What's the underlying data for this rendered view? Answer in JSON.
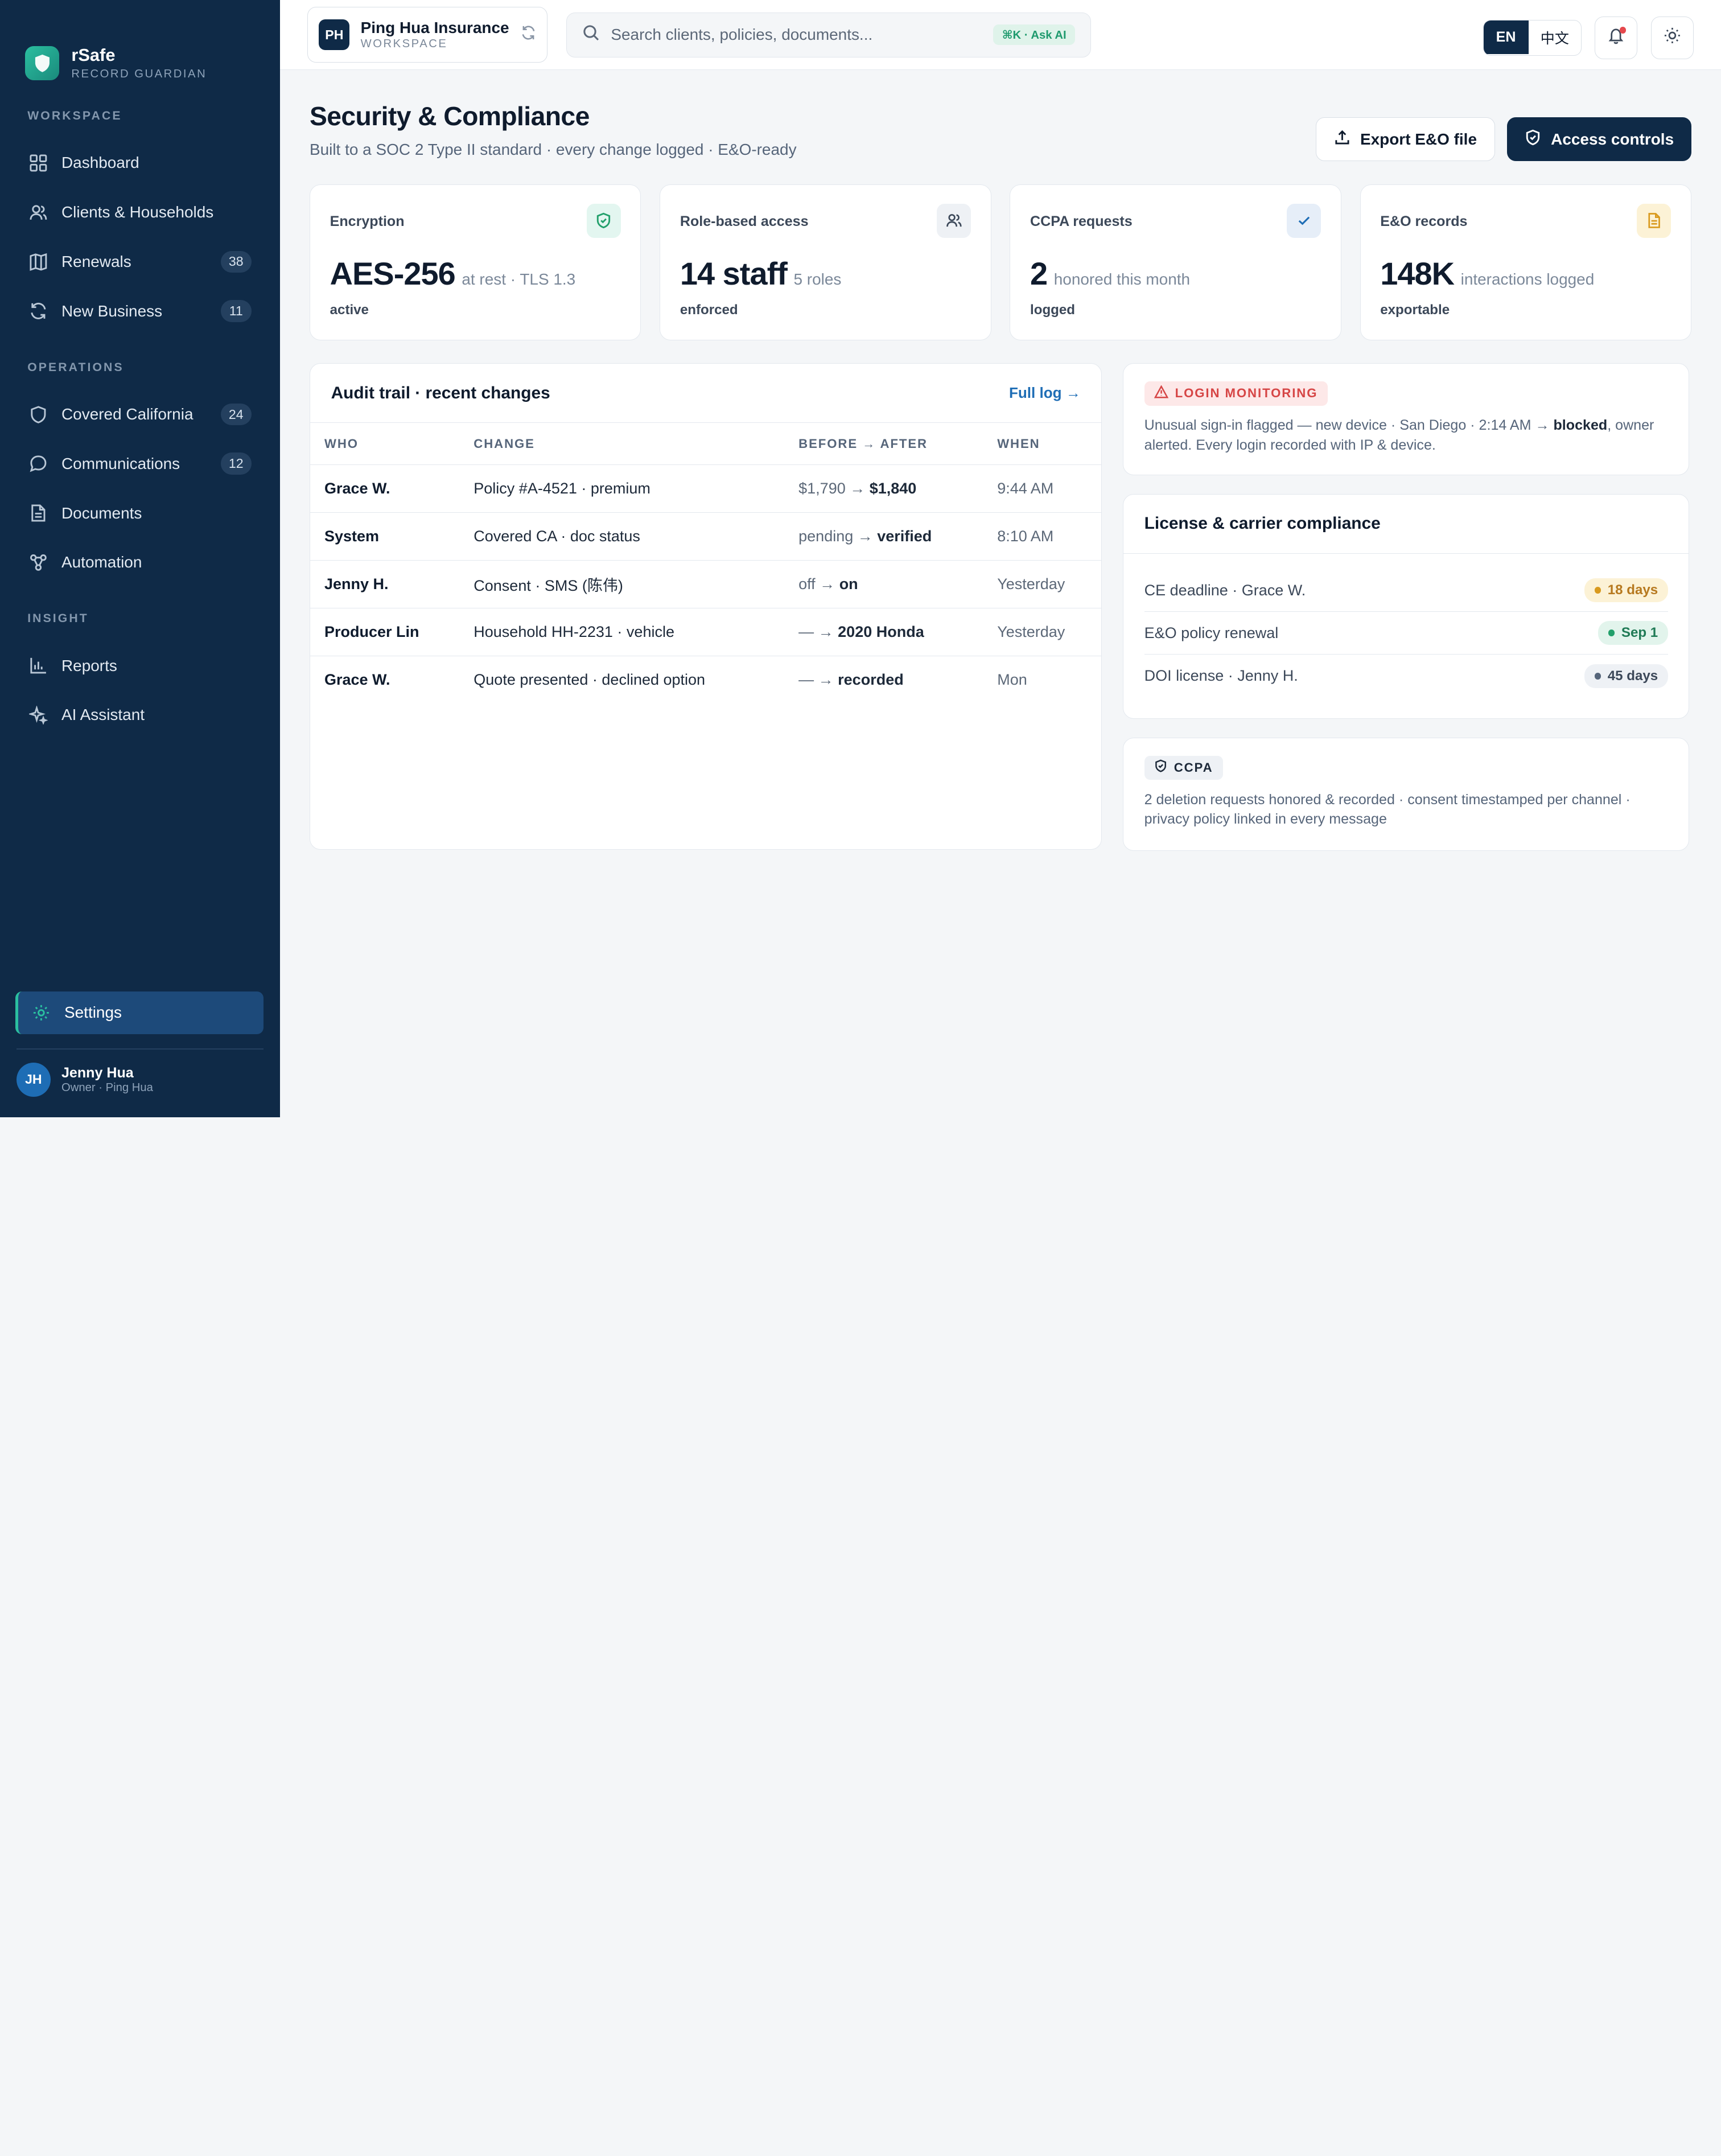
{
  "brand": {
    "name": "rSafe",
    "tagline": "RECORD GUARDIAN"
  },
  "sidebar": {
    "sections": [
      {
        "title": "WORKSPACE",
        "items": [
          {
            "label": "Dashboard",
            "icon": "grid-icon"
          },
          {
            "label": "Clients & Households",
            "icon": "users-icon"
          },
          {
            "label": "Renewals",
            "icon": "map-icon",
            "badge": "38"
          },
          {
            "label": "New Business",
            "icon": "refresh-icon",
            "badge": "11"
          }
        ]
      },
      {
        "title": "OPERATIONS",
        "items": [
          {
            "label": "Covered California",
            "icon": "shield-icon",
            "badge": "24"
          },
          {
            "label": "Communications",
            "icon": "chat-icon",
            "badge": "12"
          },
          {
            "label": "Documents",
            "icon": "document-icon"
          },
          {
            "label": "Automation",
            "icon": "workflow-icon"
          }
        ]
      },
      {
        "title": "INSIGHT",
        "items": [
          {
            "label": "Reports",
            "icon": "bar-chart-icon"
          },
          {
            "label": "AI Assistant",
            "icon": "sparkle-icon"
          }
        ]
      }
    ],
    "settings_label": "Settings",
    "user": {
      "initials": "JH",
      "name": "Jenny Hua",
      "role": "Owner · Ping Hua"
    }
  },
  "topbar": {
    "workspace": {
      "initials": "PH",
      "name": "Ping Hua Insurance",
      "sub": "WORKSPACE"
    },
    "search_placeholder": "Search clients, policies, documents...",
    "search_shortcut": "⌘K · Ask AI",
    "lang_en": "EN",
    "lang_zh": "中文"
  },
  "page": {
    "title": "Security & Compliance",
    "subtitle": "Built to a SOC 2 Type II standard · every change logged · E&O-ready",
    "export_label": "Export E&O file",
    "access_label": "Access controls"
  },
  "stats": [
    {
      "label": "Encryption",
      "value": "AES-256",
      "unit": "at rest · TLS 1.3",
      "status": "active",
      "icon": "shield-check-icon",
      "accent": "#2bbfa0"
    },
    {
      "label": "Role-based access",
      "value": "14 staff",
      "unit": "5 roles",
      "status": "enforced",
      "icon": "users-icon",
      "accent": "#3c4859"
    },
    {
      "label": "CCPA requests",
      "value": "2",
      "unit": "honored this month",
      "status": "logged",
      "icon": "check-icon",
      "accent": "#1e6db5"
    },
    {
      "label": "E&O records",
      "value": "148K",
      "unit": "interactions logged",
      "status": "exportable",
      "icon": "document-icon",
      "accent": "#d99a1e"
    }
  ],
  "audit": {
    "title": "Audit trail · recent changes",
    "link": "Full log →",
    "columns": [
      "WHO",
      "CHANGE",
      "BEFORE → AFTER",
      "WHEN"
    ],
    "rows": [
      {
        "who": "Grace W.",
        "change": "Policy #A-4521 · premium",
        "before": "$1,790 → ",
        "after": "$1,840",
        "when": "9:44 AM"
      },
      {
        "who": "System",
        "change": "Covered CA · doc status",
        "before": "pending → ",
        "after": "verified",
        "when": "8:10 AM"
      },
      {
        "who": "Jenny H.",
        "change": "Consent · SMS (陈伟)",
        "before": "off → ",
        "after": "on",
        "when": "Yesterday"
      },
      {
        "who": "Producer Lin",
        "change": "Household HH-2231 · vehicle",
        "before": "— → ",
        "after": "2020 Honda",
        "when": "Yesterday"
      },
      {
        "who": "Grace W.",
        "change": "Quote presented · declined option",
        "before": "— → ",
        "after": "recorded",
        "when": "Mon"
      }
    ]
  },
  "login": {
    "pill": "LOGIN MONITORING",
    "text_before": "Unusual sign-in flagged — new device · San Diego · 2:14 AM → ",
    "text_bold": "blocked",
    "text_after": ", owner alerted. Every login recorded with IP & device."
  },
  "license": {
    "title": "License & carrier compliance",
    "rows": [
      {
        "label": "CE deadline · Grace W.",
        "tag": "18 days",
        "tone": "amber"
      },
      {
        "label": "E&O policy renewal",
        "tag": "Sep 1",
        "tone": "green"
      },
      {
        "label": "DOI license · Jenny H.",
        "tag": "45 days",
        "tone": "gray"
      }
    ]
  },
  "ccpa": {
    "pill": "CCPA",
    "text": "2 deletion requests honored & recorded · consent timestamped per channel · privacy policy linked in every message"
  }
}
